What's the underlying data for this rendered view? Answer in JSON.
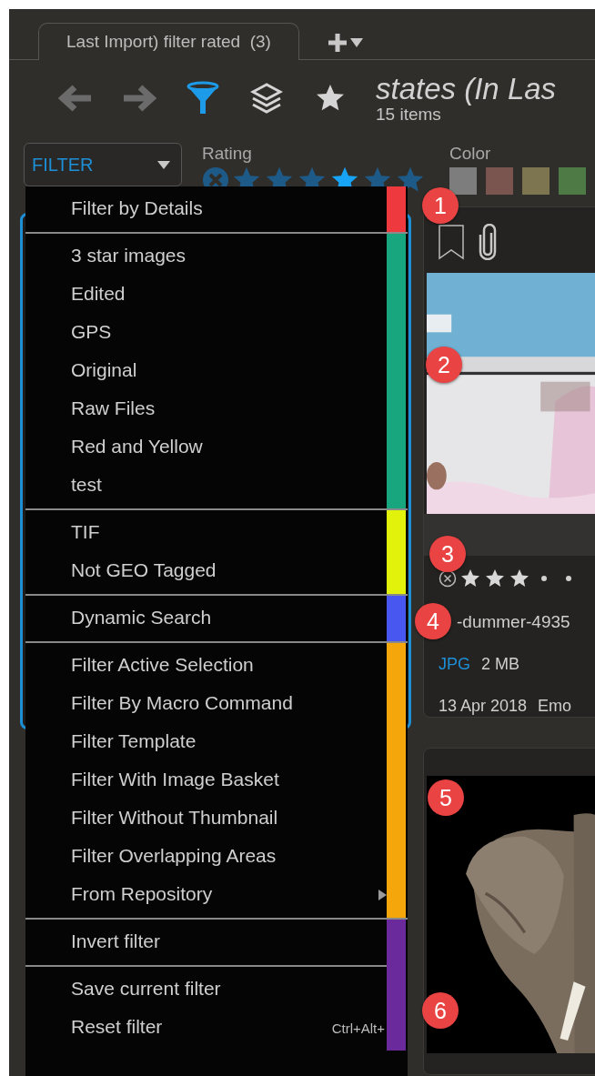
{
  "tabs": [
    {
      "label": "Last Import) filter rated  (3)",
      "selected": true
    }
  ],
  "toolbar": [
    {
      "kind": "back",
      "active": false
    },
    {
      "kind": "forward",
      "active": false
    },
    {
      "kind": "filter",
      "active": true
    },
    {
      "kind": "layers",
      "active": false
    },
    {
      "kind": "star",
      "active": false
    }
  ],
  "header": {
    "title": "states (In Las",
    "subtitle": "15 items"
  },
  "filter_bar": {
    "dropdown": {
      "value": "FILTER"
    },
    "rating": {
      "label": "Rating",
      "stars": [
        {
          "selected": false
        },
        {
          "selected": false
        },
        {
          "selected": false
        },
        {
          "selected": true
        },
        {
          "selected": false
        },
        {
          "selected": false
        }
      ]
    },
    "color": {
      "label": "Color",
      "swatches": [
        {
          "color": "#7d7d7d"
        },
        {
          "color": "#7a5550"
        },
        {
          "color": "#7d7550"
        },
        {
          "color": "#4e7a45"
        }
      ]
    }
  },
  "menu": {
    "groups": [
      {
        "color": "#ee3a3f",
        "sections": [
          [
            {
              "label": "Filter by Details"
            }
          ]
        ]
      },
      {
        "color": "#17a67e",
        "sections": [
          [
            {
              "label": "3 star images"
            },
            {
              "label": "Edited"
            },
            {
              "label": "GPS"
            },
            {
              "label": "Original"
            },
            {
              "label": "Raw Files"
            },
            {
              "label": "Red and Yellow"
            },
            {
              "label": "test"
            }
          ]
        ]
      },
      {
        "color": "#e2f20a",
        "sections": [
          [
            {
              "label": "TIF"
            },
            {
              "label": "Not GEO Tagged"
            }
          ]
        ]
      },
      {
        "color": "#4857ef",
        "sections": [
          [
            {
              "label": "Dynamic Search"
            }
          ]
        ]
      },
      {
        "color": "#f5a60a",
        "sections": [
          [
            {
              "label": "Filter Active Selection"
            },
            {
              "label": "Filter By Macro Command"
            },
            {
              "label": "Filter Template"
            },
            {
              "label": "Filter With Image Basket"
            },
            {
              "label": "Filter Without Thumbnail"
            },
            {
              "label": "Filter Overlapping Areas"
            },
            {
              "label": "From Repository",
              "submenu": true
            }
          ]
        ]
      },
      {
        "color": "#6a2a9c",
        "sections": [
          [
            {
              "label": "Invert filter"
            }
          ],
          [
            {
              "label": "Save current filter"
            },
            {
              "label": "Reset filter",
              "shortcut": "Ctrl+Alt+"
            }
          ]
        ]
      }
    ]
  },
  "cards": [
    {
      "stars": 3,
      "filename": "-dummer-4935",
      "format": "JPG",
      "size": "2 MB",
      "date": "13 Apr 2018",
      "tag": "Emo"
    }
  ],
  "callouts": [
    "1",
    "2",
    "3",
    "4",
    "5",
    "6"
  ]
}
